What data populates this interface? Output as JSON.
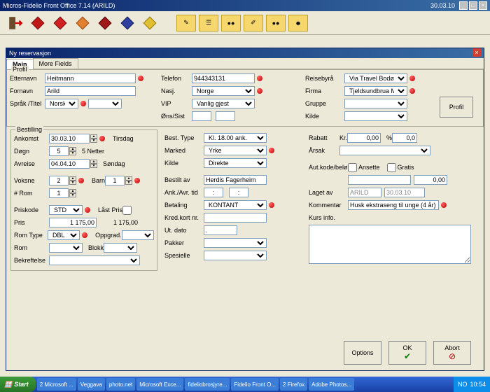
{
  "app": {
    "title": "Micros-Fidelio Front Office 7.14 (ARILD)",
    "date": "30.03.10"
  },
  "dialog": {
    "title": "Ny reservasjon",
    "tabs": {
      "main": "Main",
      "more": "More Fields"
    }
  },
  "profil": {
    "legend": "Profil",
    "etternavn_lbl": "Etternavn",
    "etternavn": "Heitmann",
    "fornavn_lbl": "Fornavn",
    "fornavn": "Arild",
    "sprak_lbl": "Språk",
    "titel_lbl": "/Titel",
    "sprak": "Norsk",
    "telefon_lbl": "Telefon",
    "telefon": "944343131",
    "nasj_lbl": "Nasj.",
    "nasj": "Norge",
    "vip_lbl": "VIP",
    "vip": "Vanlig gjest",
    "ons_lbl": "Øns/Sist",
    "reisebyra_lbl": "Reisebyrå",
    "reisebyra": "Via Travel Bodø",
    "firma_lbl": "Firma",
    "firma": "Tjeldsundbrua Maritim",
    "gruppe_lbl": "Gruppe",
    "kilde_lbl": "Kilde",
    "btn_profil": "Profil"
  },
  "bestilling": {
    "legend": "Bestilling",
    "ankomst_lbl": "Ankomst",
    "ankomst": "30.03.10",
    "ankomst_day": "Tirsdag",
    "dogn_lbl": "Døgn",
    "dogn": "5",
    "netter": "5 Netter",
    "avreise_lbl": "Avreise",
    "avreise": "04.04.10",
    "avreise_day": "Søndag",
    "voksne_lbl": "Voksne",
    "voksne": "2",
    "barn_lbl": "Barn",
    "barn": "1",
    "rom_count_lbl": "# Rom",
    "rom_count": "1",
    "priskode_lbl": "Priskode",
    "priskode": "STD",
    "lastpris_lbl": "Låst Pris",
    "pris_lbl": "Pris",
    "pris": "1 175,00",
    "pris_total": "1 175,00",
    "romtype_lbl": "Rom Type",
    "romtype": "DBL",
    "oppgrad_lbl": "Oppgrad.",
    "rom_lbl": "Rom",
    "blokk_lbl": "Blokk",
    "bekreft_lbl": "Bekreftelse"
  },
  "col2": {
    "besttype_lbl": "Best. Type",
    "besttype": "Kl. 18.00 ank.",
    "marked_lbl": "Marked",
    "marked": "Yrke",
    "kilde_lbl": "Kilde",
    "kilde": "Direkte",
    "bestilt_lbl": "Bestilt av",
    "bestilt": "Herdis Fagerheim",
    "ankavr_lbl": "Ank./Avr. tid",
    "t1": ":",
    "t2": ":",
    "betaling_lbl": "Betaling",
    "betaling": "KONTANT",
    "kredkort_lbl": "Kred.kort nr.",
    "utdato_lbl": "Ut. dato",
    "utdato": ".",
    "pakker_lbl": "Pakker",
    "spesielle_lbl": "Spesielle"
  },
  "col3": {
    "rabatt_lbl": "Rabatt",
    "kr_lbl": "Kr.",
    "rabatt_kr": "0,00",
    "pct_lbl": "%",
    "rabatt_pct": "0,0",
    "arsak_lbl": "Årsak",
    "autkode_lbl": "Aut.kode/beløp",
    "ansette_lbl": "Ansette",
    "gratis_lbl": "Gratis",
    "belop": "0,00",
    "laget_lbl": "Laget av",
    "laget_by": "ARILD",
    "laget_date": "30.03.10",
    "kommentar_lbl": "Kommentar",
    "kommentar": "Husk ekstraseng til unge (4 år)",
    "kurs_lbl": "Kurs info."
  },
  "footer": {
    "options": "Options",
    "ok": "OK",
    "abort": "Abort"
  },
  "taskbar": {
    "start": "Start",
    "tasks": [
      "2 Microsoft ...",
      "Veggava",
      "photo.net",
      "Microsoft Exce...",
      "fideliobrosjyre...",
      "Fidelio Front O...",
      "2 Firefox",
      "Adobe Photos..."
    ],
    "time": "10:54",
    "lang": "NO"
  }
}
